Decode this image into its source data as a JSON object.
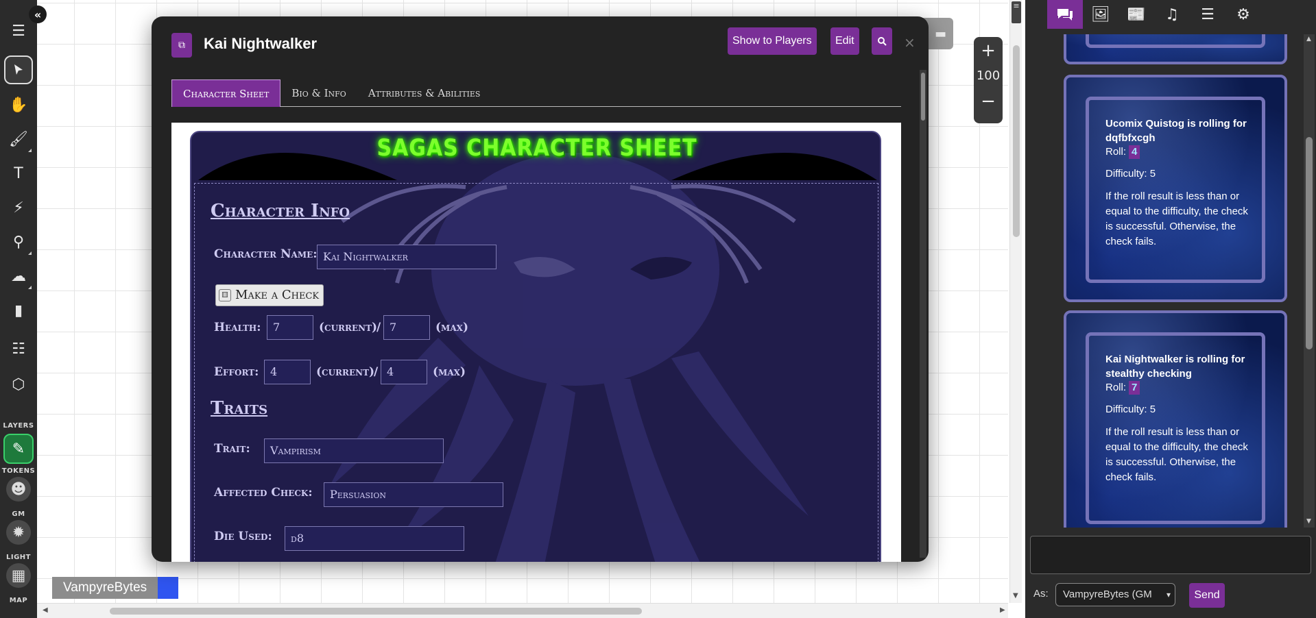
{
  "toolbar": {
    "layers_label": "LAYERS",
    "tokens_label": "TOKENS",
    "gm_label": "GM",
    "light_label": "LIGHT",
    "map_label": "MAP"
  },
  "zoom": {
    "plus": "+",
    "value": "100",
    "minus": "−"
  },
  "player": {
    "name": "VampyreBytes",
    "color": "#2f55f0"
  },
  "dialog": {
    "title": "Kai Nightwalker",
    "buttons": {
      "show_to_players": "Show to Players",
      "edit": "Edit"
    },
    "close": "×",
    "tabs": [
      "Character Sheet",
      "Bio & Info",
      "Attributes & Abilities"
    ]
  },
  "sheet": {
    "title": "SAGAS CHARACTER SHEET",
    "character_info_heading": "Character Info",
    "character_name_label": "Character Name:",
    "character_name_value": "Kai Nightwalker",
    "make_check_label": "Make a Check",
    "health_label": "Health:",
    "health_current": "7",
    "health_max": "7",
    "effort_label": "Effort:",
    "effort_current": "4",
    "effort_max": "4",
    "current_label": "(current)",
    "slash": "/",
    "max_label": "(max)",
    "traits_heading": "Traits",
    "trait_label": "Trait:",
    "trait_value": "Vampirism",
    "affected_check_label": "Affected Check:",
    "affected_check_value": "Persuasion",
    "die_used_label": "Die Used:",
    "die_used_value": "d8"
  },
  "chat": {
    "rolls": [
      {
        "title": "Ucomix Quistog is rolling for dqfbfxcgh",
        "roll_label": "Roll:",
        "roll_value": "4",
        "difficulty": "Difficulty: 5",
        "note": "If the roll result is less than or equal to the difficulty, the check is successful. Otherwise, the check fails."
      },
      {
        "title": "Kai Nightwalker is rolling for stealthy checking",
        "roll_label": "Roll:",
        "roll_value": "7",
        "difficulty": "Difficulty: 5",
        "note": "If the roll result is less than or equal to the difficulty, the check is successful. Otherwise, the check fails."
      }
    ],
    "as_label": "As:",
    "as_value": "VampyreBytes (GM",
    "send_label": "Send"
  },
  "colors": {
    "accent": "#7a2f97",
    "sheet_bg": "#201c4a",
    "title_green": "#7cff2c",
    "active_layer": "#1e7a3c"
  }
}
